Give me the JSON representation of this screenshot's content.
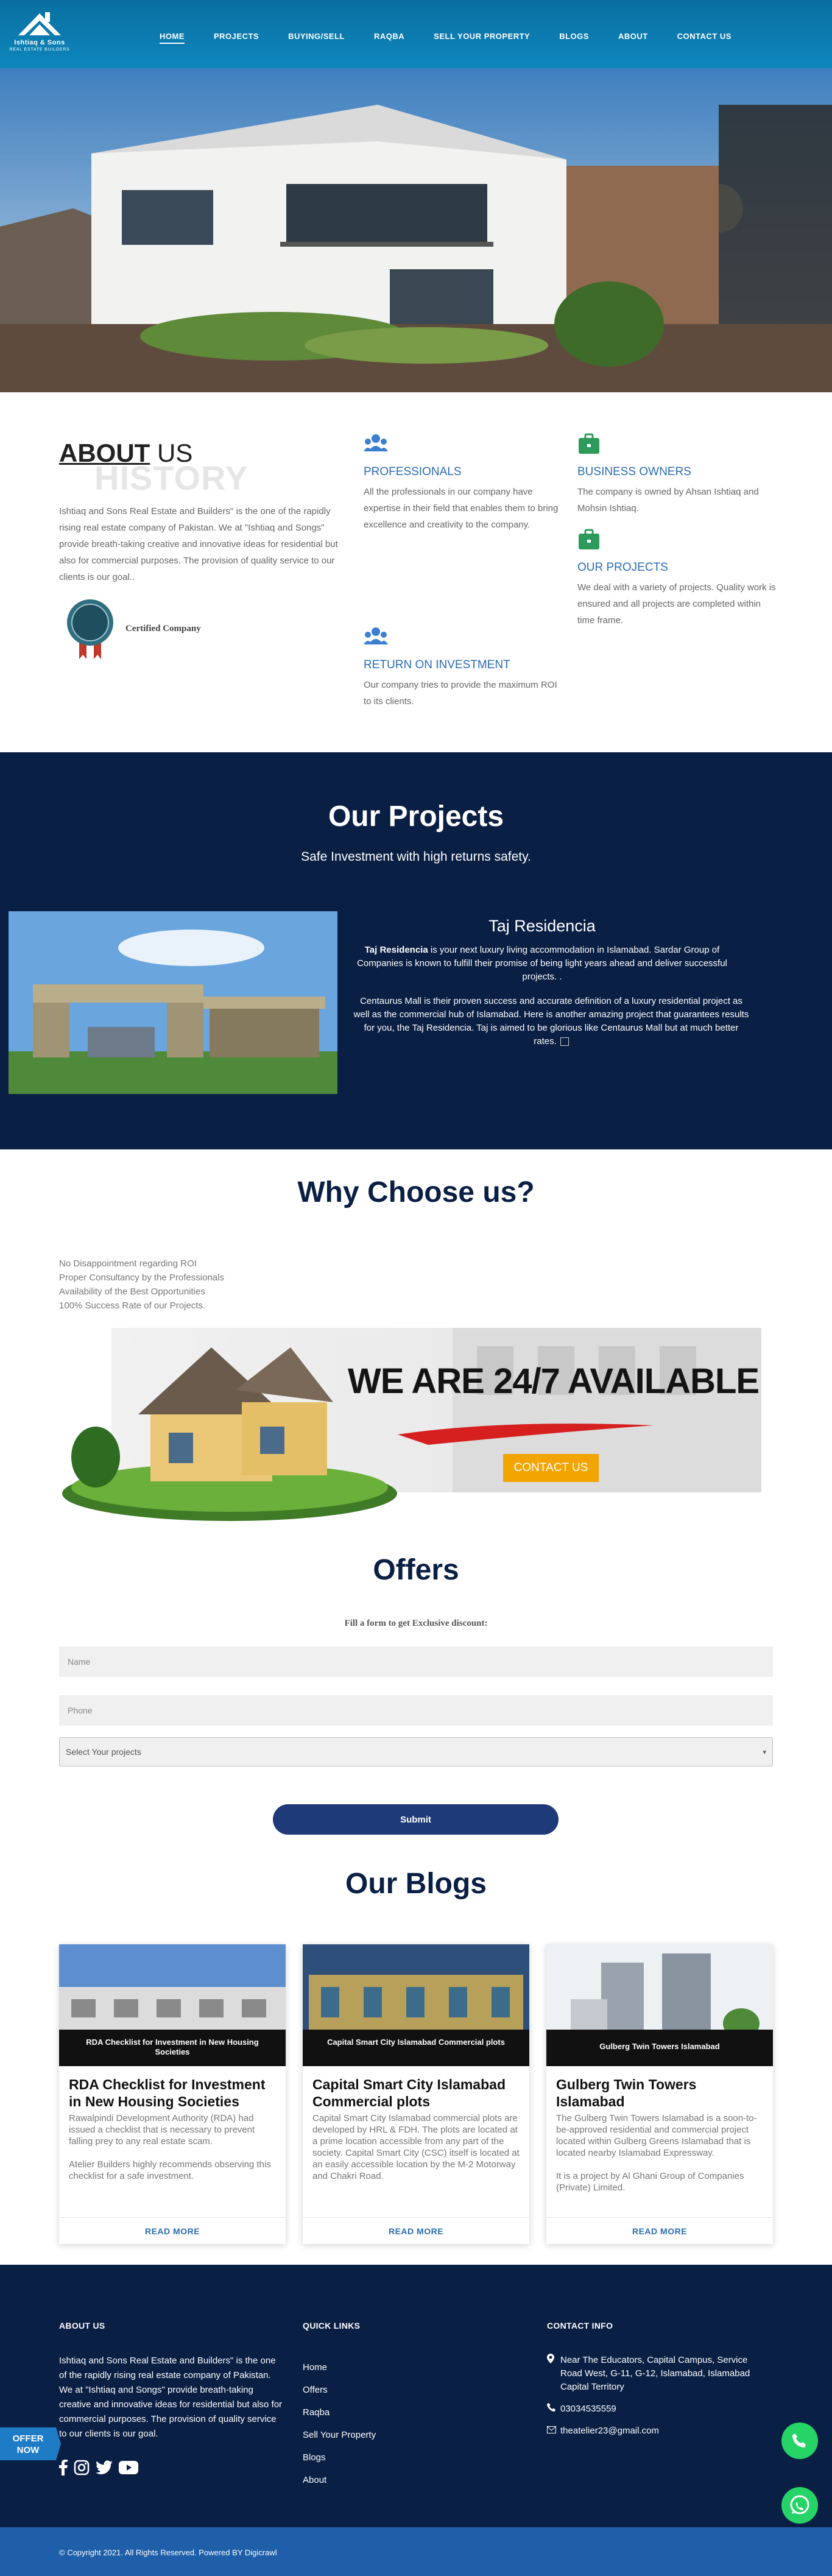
{
  "header": {
    "logo_brand": "Ishtiaq & Sons",
    "logo_sub": "REAL ESTATE BUILDERS",
    "nav": [
      "HOME",
      "PROJECTS",
      "BUYING/SELL",
      "RAQBA",
      "SELL YOUR PROPERTY",
      "BLOGS",
      "ABOUT",
      "CONTACT US"
    ]
  },
  "about": {
    "title_bold": "ABOUT",
    "title_rest": " US",
    "ghost": "HISTORY",
    "text": "Ishtiaq and Sons Real Estate and Builders\" is the one of the rapidly rising real estate company of Pakistan. We at \"Ishtiaq and Songs\" provide breath-taking creative and innovative ideas for residential but also for commercial purposes. The provision of quality service to our clients is our goal..",
    "certified": "Certified Company",
    "features": [
      {
        "title": "PROFESSIONALS",
        "text": "All the professionals in our company have expertise in their field that enables them to bring excellence and creativity to the company."
      },
      {
        "title": "BUSINESS OWNERS",
        "text": "The company is owned by Ahsan Ishtiaq and Mohsin Ishtiaq."
      },
      {
        "title": "OUR PROJECTS",
        "text": "We deal with a variety of projects. Quality work is ensured and all projects are completed within time frame."
      },
      {
        "title": "RETURN ON INVESTMENT",
        "text": "Our company tries to provide the maximum ROI to its clients."
      }
    ]
  },
  "projects": {
    "heading": "Our Projects",
    "subheading": "Safe Investment with high returns safety.",
    "name": "Taj Residencia",
    "p1_bold": "Taj Residencia",
    "p1_rest": " is your next luxury living accommodation in Islamabad. Sardar Group of Companies is known to fulfill their promise of being light years ahead and deliver successful projects. .",
    "p2": "Centaurus Mall is their proven success and accurate definition of a luxury residential project as well as the commercial hub of Islamabad. Here is another amazing project that guarantees results for you, the Taj Residencia. Taj is aimed to be glorious like Centaurus Mall but at much better rates."
  },
  "why": {
    "heading": "Why Choose us?",
    "items": [
      "No Disappointment regarding ROI",
      "Proper Consultancy by the Professionals",
      "Availability of the Best Opportunities",
      "100% Success Rate of our Projects."
    ],
    "banner_text": "WE ARE 24/7 AVAILABLE",
    "banner_button": "CONTACT US"
  },
  "offers": {
    "heading": "Offers",
    "subheading": "Fill a form to get Exclusive discount:",
    "name_placeholder": "Name",
    "phone_placeholder": "Phone",
    "select_value": "Select Your projects",
    "submit": "Submit"
  },
  "blogs": {
    "heading": "Our Blogs",
    "read_more": "READ MORE",
    "cards": [
      {
        "caption": "RDA Checklist for Investment in New Housing Societies",
        "title": "RDA Checklist for Investment in New Housing Societies",
        "body1": "Rawalpindi Development Authority (RDA) had issued a checklist that is necessary to prevent falling prey to any real estate scam.",
        "body2": "Atelier Builders highly recommends observing this checklist for a safe investment."
      },
      {
        "caption": "Capital Smart City Islamabad Commercial plots",
        "title": "Capital Smart City Islamabad Commercial plots",
        "body1": "Capital Smart City Islamabad commercial plots are developed by HRL & FDH. The plots are located at a prime location accessible from any part of the society. Capital Smart City (CSC) itself is located at an easily accessible location by the M-2 Motorway and Chakri Road.",
        "body2": ""
      },
      {
        "caption": "Gulberg Twin Towers Islamabad",
        "title": "Gulberg Twin Towers Islamabad",
        "body1": "The Gulberg Twin Towers Islamabad is a soon-to-be-approved residential and commercial project located within Gulberg Greens Islamabad that is located nearby Islamabad Expressway.",
        "body2": "It is a project by Al Ghani Group of Companies (Private) Limited."
      }
    ]
  },
  "footer": {
    "about_h": "ABOUT US",
    "about_text": "Ishtiaq and Sons Real Estate and Builders\" is the one of the rapidly rising real estate company of Pakistan. We at \"Ishtiaq and Songs\" provide breath-taking creative and innovative ideas for residential but also for commercial purposes. The provision of quality service to our clients is our goal.",
    "links_h": "QUICK LINKS",
    "links": [
      "Home",
      "Offers",
      "Raqba",
      "Sell Your Property",
      "Blogs",
      "About"
    ],
    "contact_h": "CONTACT INFO",
    "address": "Near The Educators, Capital Campus, Service Road West, G-11, G-12, Islamabad, Islamabad Capital Territory",
    "phone": "03034535559",
    "email": "theatelier23@gmail.com",
    "copyright": "© Copyright 2021. All Rights Reserved. Powered BY Digicrawl"
  },
  "offer_badge": {
    "line1": "OFFER",
    "line2": "NOW"
  },
  "colors": {
    "header": "#0d86bd",
    "navy": "#0a1f44",
    "accent_blue": "#2a6cb5",
    "orange": "#f2a500",
    "whatsapp": "#25d366"
  }
}
